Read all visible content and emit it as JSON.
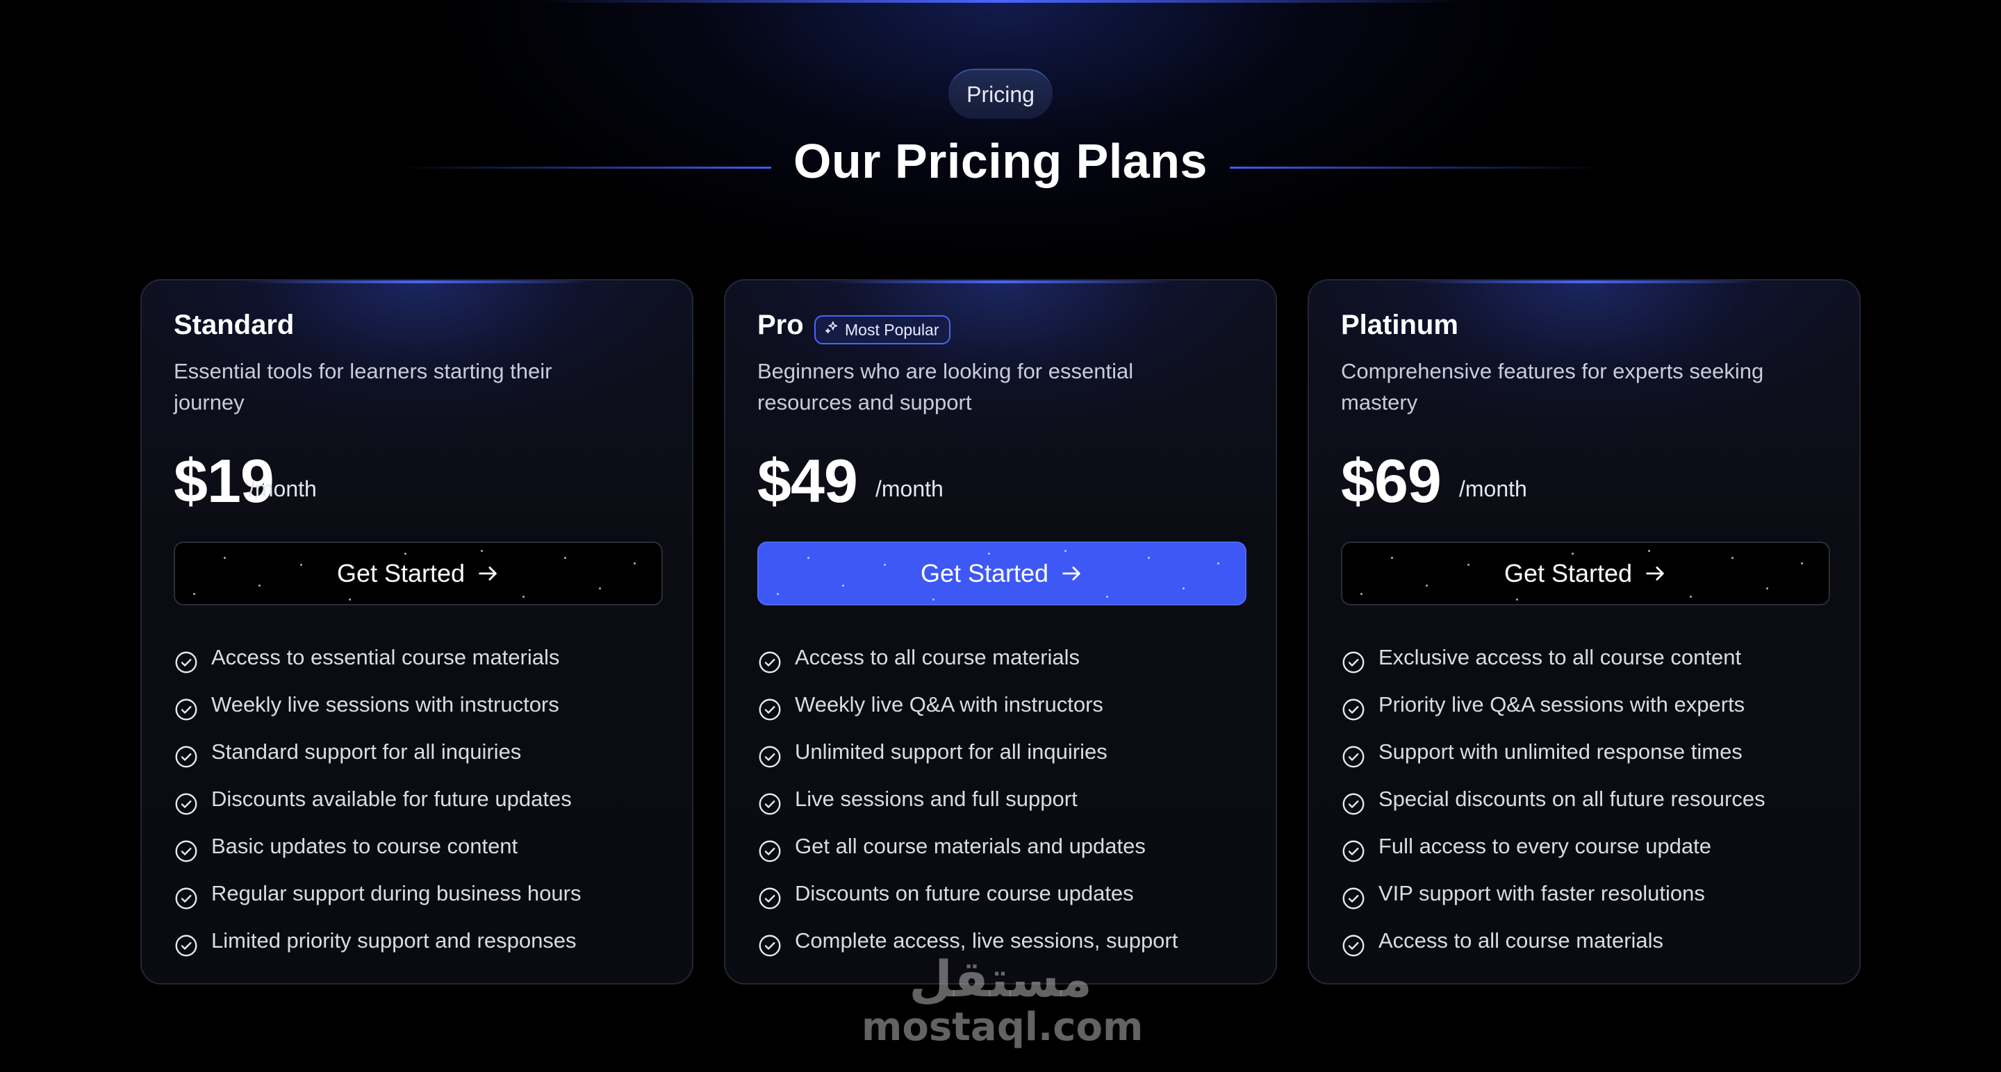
{
  "section": {
    "badge": "Pricing",
    "heading": "Our Pricing Plans"
  },
  "colors": {
    "accent": "#3e58f5",
    "background": "#000000",
    "card_border": "#232633"
  },
  "plans": [
    {
      "name": "Standard",
      "description": "Essential tools for learners starting their journey",
      "price": "$19",
      "period": "/month",
      "cta": "Get Started",
      "features": [
        "Access to essential course materials",
        "Weekly live sessions with instructors",
        "Standard support for all inquiries",
        "Discounts available for future updates",
        "Basic updates to course content",
        "Regular support during business hours",
        "Limited priority support and responses"
      ]
    },
    {
      "name": "Pro",
      "tag": "Most Popular",
      "tag_icon": "sparkles-icon",
      "description": "Beginners who are looking for essential resources and support",
      "price": "$49",
      "period": "/month",
      "cta": "Get Started",
      "features": [
        "Access to all course materials",
        "Weekly live Q&A with instructors",
        "Unlimited support for all inquiries",
        "Live sessions and full support",
        "Get all course materials and updates",
        "Discounts on future course updates",
        "Complete access, live sessions, support"
      ]
    },
    {
      "name": "Platinum",
      "description": "Comprehensive features for experts seeking mastery",
      "price": "$69",
      "period": "/month",
      "cta": "Get Started",
      "features": [
        "Exclusive access to all course content",
        "Priority live Q&A sessions with experts",
        "Support with unlimited response times",
        "Special discounts on all future resources",
        "Full access to every course update",
        "VIP support with faster resolutions",
        "Access to all course materials"
      ]
    }
  ],
  "icons": {
    "feature": "check-circle-icon",
    "cta": "arrow-right-icon"
  },
  "watermark": {
    "arabic": "مستقل",
    "latin": "mostaql.com"
  }
}
